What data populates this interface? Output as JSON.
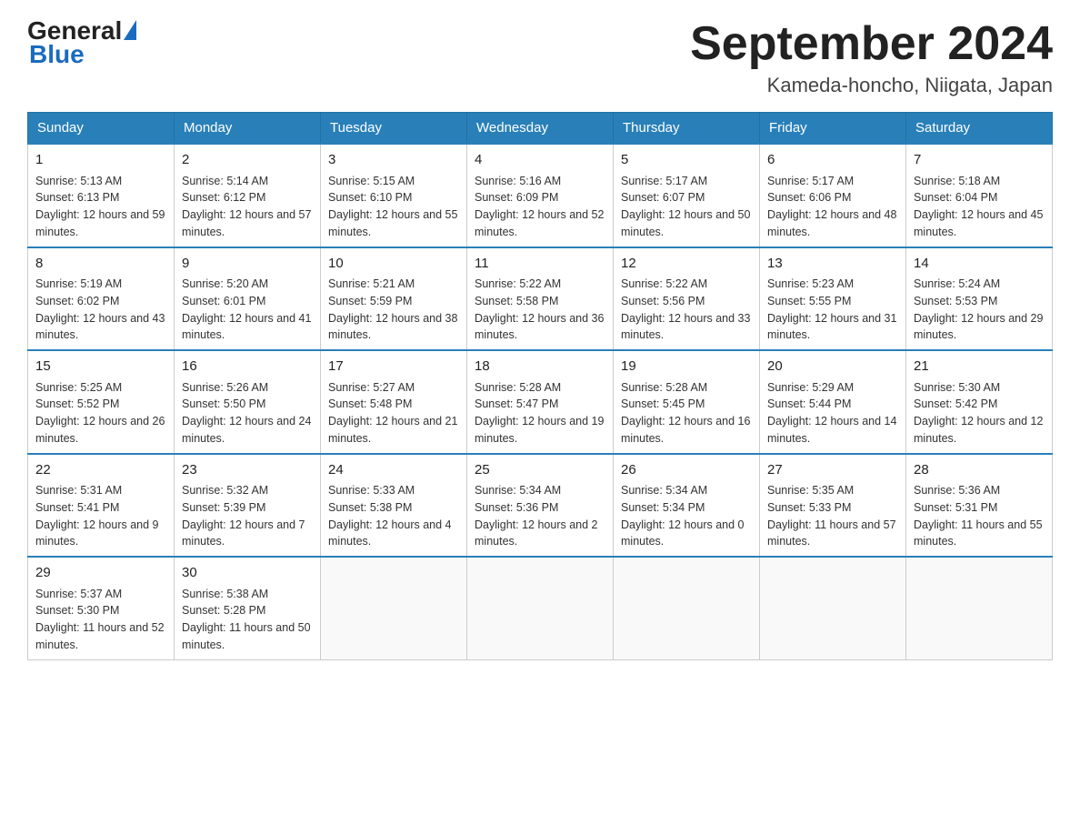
{
  "logo": {
    "general": "General",
    "blue": "Blue"
  },
  "title": "September 2024",
  "location": "Kameda-honcho, Niigata, Japan",
  "weekdays": [
    "Sunday",
    "Monday",
    "Tuesday",
    "Wednesday",
    "Thursday",
    "Friday",
    "Saturday"
  ],
  "weeks": [
    [
      {
        "day": "1",
        "sunrise": "Sunrise: 5:13 AM",
        "sunset": "Sunset: 6:13 PM",
        "daylight": "Daylight: 12 hours and 59 minutes."
      },
      {
        "day": "2",
        "sunrise": "Sunrise: 5:14 AM",
        "sunset": "Sunset: 6:12 PM",
        "daylight": "Daylight: 12 hours and 57 minutes."
      },
      {
        "day": "3",
        "sunrise": "Sunrise: 5:15 AM",
        "sunset": "Sunset: 6:10 PM",
        "daylight": "Daylight: 12 hours and 55 minutes."
      },
      {
        "day": "4",
        "sunrise": "Sunrise: 5:16 AM",
        "sunset": "Sunset: 6:09 PM",
        "daylight": "Daylight: 12 hours and 52 minutes."
      },
      {
        "day": "5",
        "sunrise": "Sunrise: 5:17 AM",
        "sunset": "Sunset: 6:07 PM",
        "daylight": "Daylight: 12 hours and 50 minutes."
      },
      {
        "day": "6",
        "sunrise": "Sunrise: 5:17 AM",
        "sunset": "Sunset: 6:06 PM",
        "daylight": "Daylight: 12 hours and 48 minutes."
      },
      {
        "day": "7",
        "sunrise": "Sunrise: 5:18 AM",
        "sunset": "Sunset: 6:04 PM",
        "daylight": "Daylight: 12 hours and 45 minutes."
      }
    ],
    [
      {
        "day": "8",
        "sunrise": "Sunrise: 5:19 AM",
        "sunset": "Sunset: 6:02 PM",
        "daylight": "Daylight: 12 hours and 43 minutes."
      },
      {
        "day": "9",
        "sunrise": "Sunrise: 5:20 AM",
        "sunset": "Sunset: 6:01 PM",
        "daylight": "Daylight: 12 hours and 41 minutes."
      },
      {
        "day": "10",
        "sunrise": "Sunrise: 5:21 AM",
        "sunset": "Sunset: 5:59 PM",
        "daylight": "Daylight: 12 hours and 38 minutes."
      },
      {
        "day": "11",
        "sunrise": "Sunrise: 5:22 AM",
        "sunset": "Sunset: 5:58 PM",
        "daylight": "Daylight: 12 hours and 36 minutes."
      },
      {
        "day": "12",
        "sunrise": "Sunrise: 5:22 AM",
        "sunset": "Sunset: 5:56 PM",
        "daylight": "Daylight: 12 hours and 33 minutes."
      },
      {
        "day": "13",
        "sunrise": "Sunrise: 5:23 AM",
        "sunset": "Sunset: 5:55 PM",
        "daylight": "Daylight: 12 hours and 31 minutes."
      },
      {
        "day": "14",
        "sunrise": "Sunrise: 5:24 AM",
        "sunset": "Sunset: 5:53 PM",
        "daylight": "Daylight: 12 hours and 29 minutes."
      }
    ],
    [
      {
        "day": "15",
        "sunrise": "Sunrise: 5:25 AM",
        "sunset": "Sunset: 5:52 PM",
        "daylight": "Daylight: 12 hours and 26 minutes."
      },
      {
        "day": "16",
        "sunrise": "Sunrise: 5:26 AM",
        "sunset": "Sunset: 5:50 PM",
        "daylight": "Daylight: 12 hours and 24 minutes."
      },
      {
        "day": "17",
        "sunrise": "Sunrise: 5:27 AM",
        "sunset": "Sunset: 5:48 PM",
        "daylight": "Daylight: 12 hours and 21 minutes."
      },
      {
        "day": "18",
        "sunrise": "Sunrise: 5:28 AM",
        "sunset": "Sunset: 5:47 PM",
        "daylight": "Daylight: 12 hours and 19 minutes."
      },
      {
        "day": "19",
        "sunrise": "Sunrise: 5:28 AM",
        "sunset": "Sunset: 5:45 PM",
        "daylight": "Daylight: 12 hours and 16 minutes."
      },
      {
        "day": "20",
        "sunrise": "Sunrise: 5:29 AM",
        "sunset": "Sunset: 5:44 PM",
        "daylight": "Daylight: 12 hours and 14 minutes."
      },
      {
        "day": "21",
        "sunrise": "Sunrise: 5:30 AM",
        "sunset": "Sunset: 5:42 PM",
        "daylight": "Daylight: 12 hours and 12 minutes."
      }
    ],
    [
      {
        "day": "22",
        "sunrise": "Sunrise: 5:31 AM",
        "sunset": "Sunset: 5:41 PM",
        "daylight": "Daylight: 12 hours and 9 minutes."
      },
      {
        "day": "23",
        "sunrise": "Sunrise: 5:32 AM",
        "sunset": "Sunset: 5:39 PM",
        "daylight": "Daylight: 12 hours and 7 minutes."
      },
      {
        "day": "24",
        "sunrise": "Sunrise: 5:33 AM",
        "sunset": "Sunset: 5:38 PM",
        "daylight": "Daylight: 12 hours and 4 minutes."
      },
      {
        "day": "25",
        "sunrise": "Sunrise: 5:34 AM",
        "sunset": "Sunset: 5:36 PM",
        "daylight": "Daylight: 12 hours and 2 minutes."
      },
      {
        "day": "26",
        "sunrise": "Sunrise: 5:34 AM",
        "sunset": "Sunset: 5:34 PM",
        "daylight": "Daylight: 12 hours and 0 minutes."
      },
      {
        "day": "27",
        "sunrise": "Sunrise: 5:35 AM",
        "sunset": "Sunset: 5:33 PM",
        "daylight": "Daylight: 11 hours and 57 minutes."
      },
      {
        "day": "28",
        "sunrise": "Sunrise: 5:36 AM",
        "sunset": "Sunset: 5:31 PM",
        "daylight": "Daylight: 11 hours and 55 minutes."
      }
    ],
    [
      {
        "day": "29",
        "sunrise": "Sunrise: 5:37 AM",
        "sunset": "Sunset: 5:30 PM",
        "daylight": "Daylight: 11 hours and 52 minutes."
      },
      {
        "day": "30",
        "sunrise": "Sunrise: 5:38 AM",
        "sunset": "Sunset: 5:28 PM",
        "daylight": "Daylight: 11 hours and 50 minutes."
      },
      null,
      null,
      null,
      null,
      null
    ]
  ]
}
